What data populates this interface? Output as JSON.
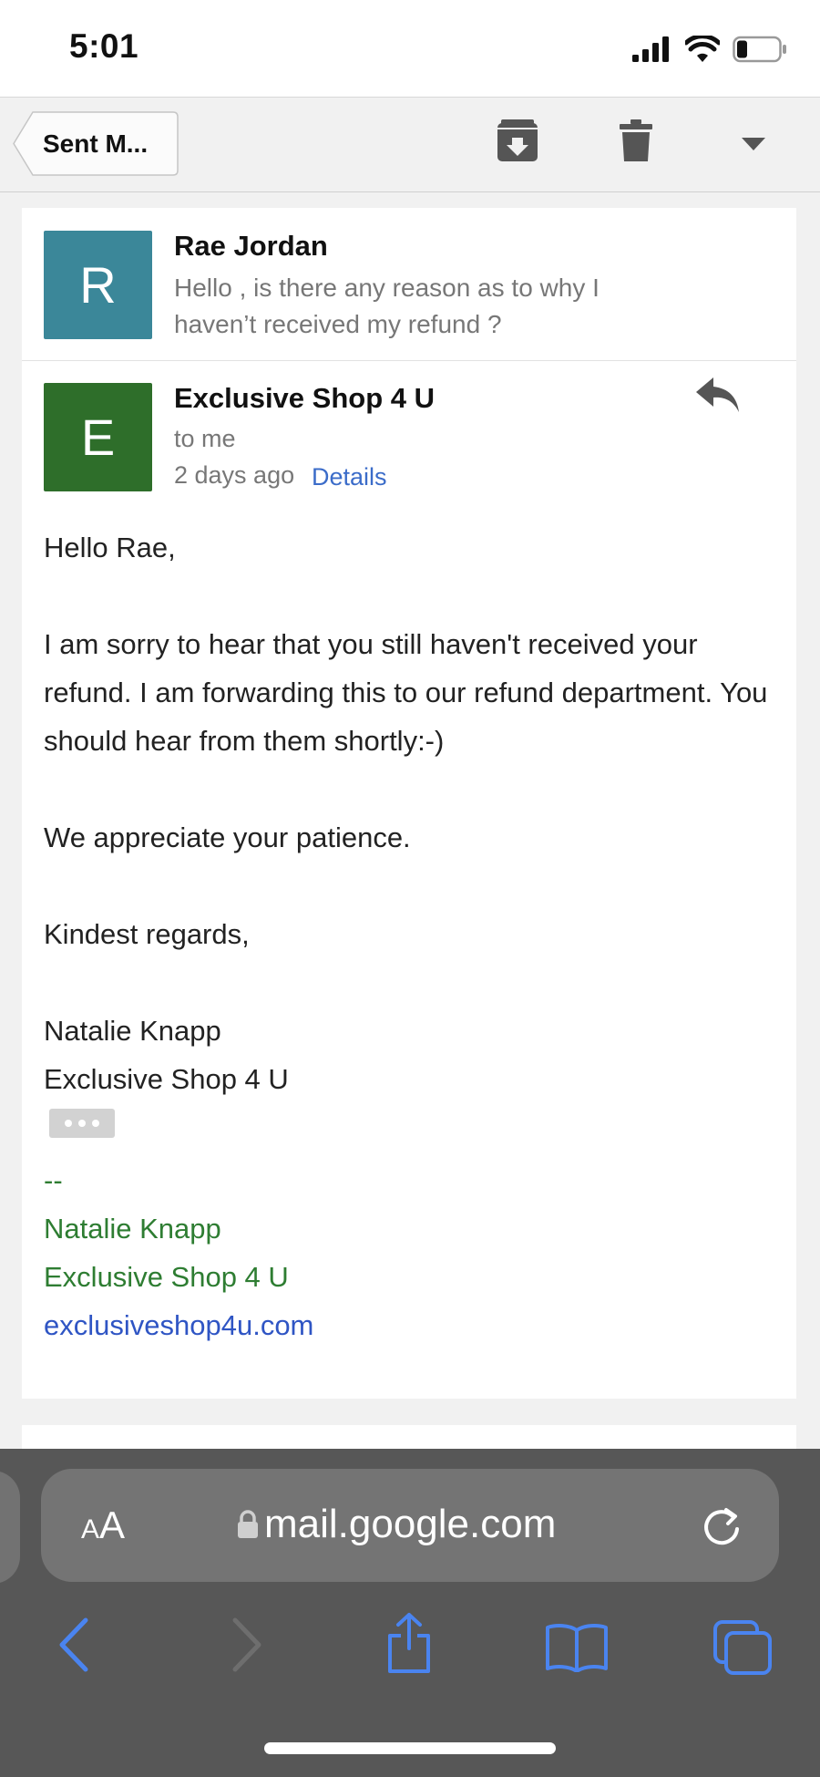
{
  "status_bar": {
    "time": "5:01",
    "battery_level": 0.25
  },
  "toolbar": {
    "back_label": "Sent M..."
  },
  "messages": [
    {
      "avatar_letter": "R",
      "avatar_color": "#3b8799",
      "sender": "Rae Jordan",
      "snippet": "Hello , is there any reason as to why I haven’t received my refund ?"
    },
    {
      "avatar_letter": "E",
      "avatar_color": "#2e6e2a",
      "sender": "Exclusive Shop 4 U",
      "recipient": "to me",
      "date": "2 days ago",
      "details_label": "Details",
      "body": {
        "greeting": "Hello Rae,",
        "paragraph1": "I am sorry to hear that you still haven't received your refund. I am forwarding this to our refund department. You should hear from them shortly:-)",
        "paragraph2": "We appreciate your patience.",
        "closing": "Kindest regards,",
        "name": "Natalie Knapp",
        "company": "Exclusive Shop 4 U"
      },
      "signature": {
        "separator": "--",
        "name": "Natalie Knapp",
        "company": "Exclusive Shop 4 U",
        "link": "exclusiveshop4u.com"
      }
    }
  ],
  "browser": {
    "aa_label_big": "A",
    "aa_label_small": "A",
    "url": "mail.google.com"
  },
  "colors": {
    "link_blue": "#3b6cc9",
    "signature_green": "#2e7d32",
    "browser_bar": "#575757",
    "safari_blue": "#4a84f0"
  }
}
